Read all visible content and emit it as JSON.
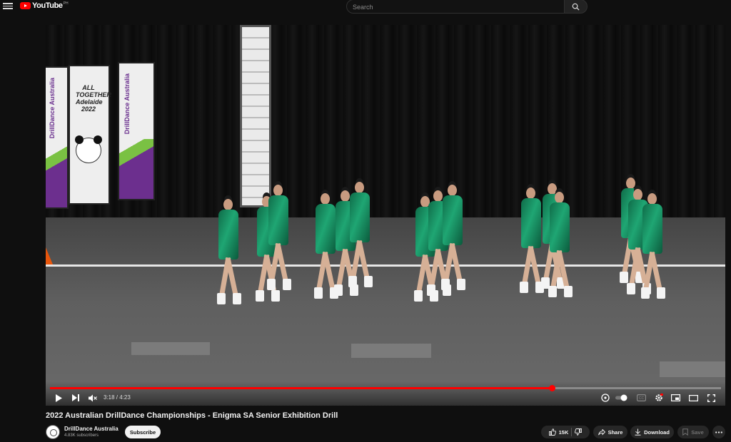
{
  "header": {
    "logo_text": "YouTube",
    "region": "PH",
    "search_placeholder": "Search"
  },
  "player": {
    "current_time": "3:18",
    "duration": "4:23",
    "time_display": "3:18 / 4:23",
    "progress_fraction": 0.748,
    "muted": true,
    "banners": [
      "DrillDance Australia",
      "ALL TOGETHER Adelaide 2022",
      "DrillDance Australia"
    ]
  },
  "video": {
    "title": "2022 Australian DrillDance Championships - Enigma SA Senior Exhibition Drill"
  },
  "channel": {
    "name": "DrillDance Australia",
    "subscribers": "4.83K subscribers",
    "subscribe_label": "Subscribe"
  },
  "actions": {
    "likes": "15K",
    "share": "Share",
    "download": "Download",
    "save": "Save"
  },
  "colors": {
    "accent": "#ff0000",
    "background": "#0f0f0f",
    "pill": "#272727"
  }
}
